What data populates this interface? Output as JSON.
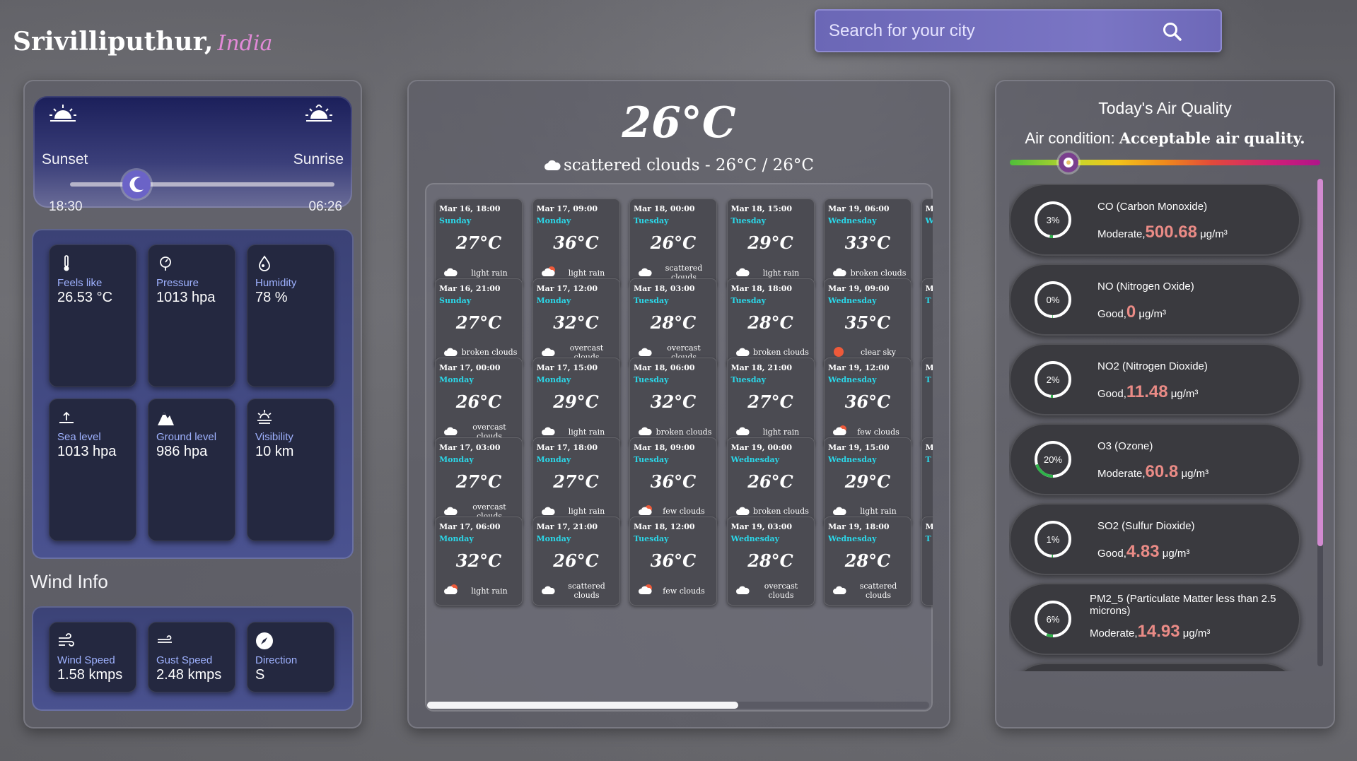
{
  "header": {
    "city": "Srivilliputhur,",
    "country": "India"
  },
  "search": {
    "placeholder": "Search for your city",
    "icon": "search-icon"
  },
  "sun": {
    "sunset_label": "Sunset",
    "sunrise_label": "Sunrise",
    "sunset_time": "18:30",
    "sunrise_time": "06:26",
    "moon_position": 0.25
  },
  "stats": [
    {
      "icon": "thermometer-icon",
      "label": "Feels like",
      "value": "26.53 °C"
    },
    {
      "icon": "pressure-gauge-icon",
      "label": "Pressure",
      "value": "1013 hpa"
    },
    {
      "icon": "humidity-drop-icon",
      "label": "Humidity",
      "value": "78 %"
    },
    {
      "icon": "sea-level-icon",
      "label": "Sea level",
      "value": "1013 hpa"
    },
    {
      "icon": "mountain-icon",
      "label": "Ground level",
      "value": "986 hpa"
    },
    {
      "icon": "visibility-icon",
      "label": "Visibility",
      "value": "10 km"
    }
  ],
  "wind": {
    "title": "Wind Info",
    "items": [
      {
        "icon": "wind-icon",
        "label": "Wind Speed",
        "value": "1.58 kmps"
      },
      {
        "icon": "gust-icon",
        "label": "Gust Speed",
        "value": "2.48 kmps"
      },
      {
        "icon": "compass-icon",
        "label": "Direction",
        "value": "S"
      }
    ]
  },
  "current": {
    "temp": "26°C",
    "description": "scattered clouds - 26°C / 26°C",
    "icon": "cloud-icon"
  },
  "forecast": [
    [
      {
        "date": "Mar 16, 18:00",
        "day": "Sunday",
        "temp": "27°C",
        "cond": "light rain",
        "icon": "cloud"
      },
      {
        "date": "Mar 16, 21:00",
        "day": "Sunday",
        "temp": "27°C",
        "cond": "broken clouds",
        "icon": "cloud"
      },
      {
        "date": "Mar 17, 00:00",
        "day": "Monday",
        "temp": "26°C",
        "cond": "overcast clouds",
        "icon": "cloud"
      },
      {
        "date": "Mar 17, 03:00",
        "day": "Monday",
        "temp": "27°C",
        "cond": "overcast clouds",
        "icon": "cloud"
      },
      {
        "date": "Mar 17, 06:00",
        "day": "Monday",
        "temp": "32°C",
        "cond": "light rain",
        "icon": "sun-cloud"
      }
    ],
    [
      {
        "date": "Mar 17, 09:00",
        "day": "Monday",
        "temp": "36°C",
        "cond": "light rain",
        "icon": "sun-cloud"
      },
      {
        "date": "Mar 17, 12:00",
        "day": "Monday",
        "temp": "32°C",
        "cond": "overcast clouds",
        "icon": "cloud"
      },
      {
        "date": "Mar 17, 15:00",
        "day": "Monday",
        "temp": "29°C",
        "cond": "light rain",
        "icon": "cloud"
      },
      {
        "date": "Mar 17, 18:00",
        "day": "Monday",
        "temp": "27°C",
        "cond": "light rain",
        "icon": "cloud"
      },
      {
        "date": "Mar 17, 21:00",
        "day": "Monday",
        "temp": "26°C",
        "cond": "scattered clouds",
        "icon": "cloud"
      }
    ],
    [
      {
        "date": "Mar 18, 00:00",
        "day": "Tuesday",
        "temp": "26°C",
        "cond": "scattered clouds",
        "icon": "cloud"
      },
      {
        "date": "Mar 18, 03:00",
        "day": "Tuesday",
        "temp": "28°C",
        "cond": "overcast clouds",
        "icon": "cloud"
      },
      {
        "date": "Mar 18, 06:00",
        "day": "Tuesday",
        "temp": "32°C",
        "cond": "broken clouds",
        "icon": "cloud"
      },
      {
        "date": "Mar 18, 09:00",
        "day": "Tuesday",
        "temp": "36°C",
        "cond": "few clouds",
        "icon": "sun-cloud"
      },
      {
        "date": "Mar 18, 12:00",
        "day": "Tuesday",
        "temp": "36°C",
        "cond": "few clouds",
        "icon": "sun-cloud"
      }
    ],
    [
      {
        "date": "Mar 18, 15:00",
        "day": "Tuesday",
        "temp": "29°C",
        "cond": "light rain",
        "icon": "cloud"
      },
      {
        "date": "Mar 18, 18:00",
        "day": "Tuesday",
        "temp": "28°C",
        "cond": "broken clouds",
        "icon": "cloud"
      },
      {
        "date": "Mar 18, 21:00",
        "day": "Tuesday",
        "temp": "27°C",
        "cond": "light rain",
        "icon": "cloud"
      },
      {
        "date": "Mar 19, 00:00",
        "day": "Wednesday",
        "temp": "26°C",
        "cond": "broken clouds",
        "icon": "cloud"
      },
      {
        "date": "Mar 19, 03:00",
        "day": "Wednesday",
        "temp": "28°C",
        "cond": "overcast clouds",
        "icon": "cloud"
      }
    ],
    [
      {
        "date": "Mar 19, 06:00",
        "day": "Wednesday",
        "temp": "33°C",
        "cond": "broken clouds",
        "icon": "cloud"
      },
      {
        "date": "Mar 19, 09:00",
        "day": "Wednesday",
        "temp": "35°C",
        "cond": "clear sky",
        "icon": "sun"
      },
      {
        "date": "Mar 19, 12:00",
        "day": "Wednesday",
        "temp": "36°C",
        "cond": "few clouds",
        "icon": "sun-cloud"
      },
      {
        "date": "Mar 19, 15:00",
        "day": "Wednesday",
        "temp": "29°C",
        "cond": "light rain",
        "icon": "cloud"
      },
      {
        "date": "Mar 19, 18:00",
        "day": "Wednesday",
        "temp": "28°C",
        "cond": "scattered clouds",
        "icon": "cloud"
      }
    ],
    [
      {
        "date": "M",
        "day": "W"
      },
      {
        "date": "M",
        "day": "T"
      },
      {
        "date": "M",
        "day": "T"
      },
      {
        "date": "M",
        "day": "T"
      },
      {
        "date": "M",
        "day": "T"
      }
    ]
  ],
  "forecast_scroll": 0.62,
  "air": {
    "title": "Today's Air Quality",
    "condition_label": "Air condition:",
    "condition_value": "Acceptable air quality.",
    "scale_position": 0.19,
    "unit": "μg/m³",
    "items": [
      {
        "name": "CO (Carbon Monoxide)",
        "quality": "Moderate,",
        "value": "500.68",
        "percent": "3%",
        "pct": 3
      },
      {
        "name": "NO (Nitrogen Oxide)",
        "quality": "Good,",
        "value": "0",
        "percent": "0%",
        "pct": 0
      },
      {
        "name": "NO2 (Nitrogen Dioxide)",
        "quality": "Good,",
        "value": "11.48",
        "percent": "2%",
        "pct": 2
      },
      {
        "name": "O3 (Ozone)",
        "quality": "Moderate,",
        "value": "60.8",
        "percent": "20%",
        "pct": 20
      },
      {
        "name": "SO2 (Sulfur Dioxide)",
        "quality": "Good,",
        "value": "4.83",
        "percent": "1%",
        "pct": 1
      },
      {
        "name": "PM2_5 (Particulate Matter less than 2.5 microns)",
        "quality": "Moderate,",
        "value": "14.93",
        "percent": "6%",
        "pct": 6
      }
    ]
  },
  "colors": {
    "accent_purple": "#e28ad8",
    "day_cyan": "#2bd7e8",
    "value_pink": "#ea8b86",
    "ring_green": "#2fb24a"
  }
}
